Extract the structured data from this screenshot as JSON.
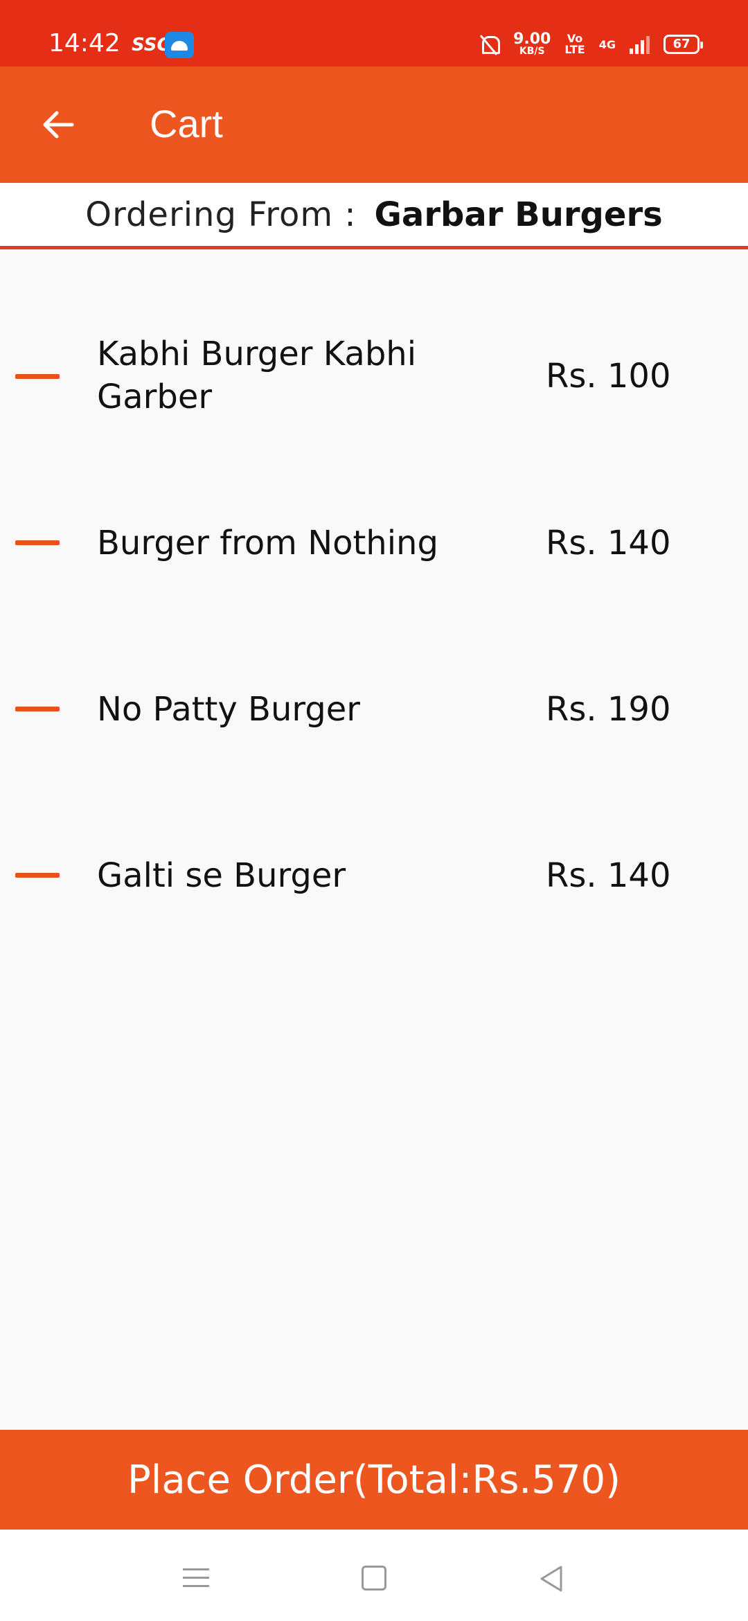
{
  "status_bar": {
    "time": "14:42",
    "carrier_tag": "SSG",
    "speed_value": "9.00",
    "speed_unit": "KB/S",
    "volte_top": "Vo",
    "volte_bottom": "LTE",
    "network": "4G",
    "battery": "67",
    "icons": [
      "app-notification-icon",
      "mute-icon",
      "signal-icon",
      "battery-icon"
    ]
  },
  "app_bar": {
    "title": "Cart",
    "back_icon": "arrow-left-icon"
  },
  "restaurant": {
    "label": "Ordering From :",
    "name": "Garbar Burgers"
  },
  "cart": {
    "remove_icon": "minus-icon",
    "items": [
      {
        "name": "Kabhi Burger Kabhi Garber",
        "price": "Rs. 100"
      },
      {
        "name": "Burger from Nothing",
        "price": "Rs. 140"
      },
      {
        "name": "No Patty Burger",
        "price": "Rs. 190"
      },
      {
        "name": "Galti se Burger",
        "price": "Rs. 140"
      }
    ]
  },
  "footer": {
    "place_order_label": "Place Order(Total:Rs.570)"
  },
  "nav_bar": {
    "icons": [
      "menu-icon",
      "home-icon",
      "back-icon"
    ]
  },
  "colors": {
    "status_bar": "#e52e16",
    "accent": "#ee561f",
    "divider": "#dd3e1d",
    "background": "#f9f9f9"
  }
}
